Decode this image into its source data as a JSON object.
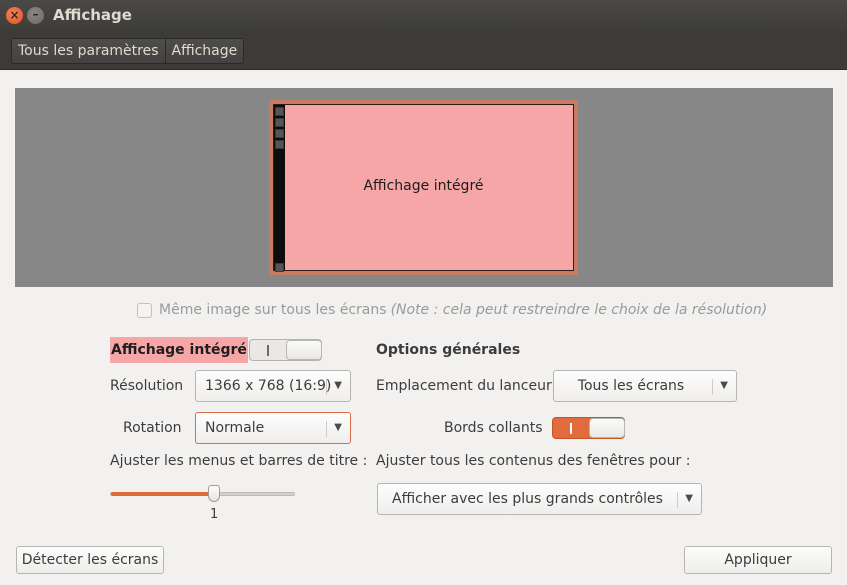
{
  "window": {
    "title": "Affichage",
    "close_glyph": "×",
    "minimize_glyph": "–"
  },
  "breadcrumb": {
    "items": [
      "Tous les paramètres",
      "Affichage"
    ]
  },
  "arrangement": {
    "monitor_label": "Affichage intégré"
  },
  "mirror": {
    "label": "Même image sur tous les écrans",
    "note": "(Note : cela peut restreindre le choix de la résolution)",
    "checked": false,
    "enabled": false
  },
  "display": {
    "name": "Affichage intégré",
    "enabled_toggle": {
      "on": false,
      "glyph": "|"
    },
    "resolution": {
      "label": "Résolution",
      "value": "1366 x 768 (16:9)"
    },
    "rotation": {
      "label": "Rotation",
      "value": "Normale"
    },
    "scale": {
      "label": "Ajuster les menus et barres de titre :",
      "value": "1",
      "level_fraction": 0.56
    }
  },
  "general": {
    "title": "Options générales",
    "launcher": {
      "label": "Emplacement du lanceur",
      "value": "Tous les écrans"
    },
    "sticky_edges": {
      "label": "Bords collants",
      "on": true,
      "glyph": "|"
    },
    "scale_all": {
      "label": "Ajuster tous les contenus des fenêtres pour :",
      "value": "Afficher avec les plus grands contrôles"
    }
  },
  "buttons": {
    "detect": "Détecter les écrans",
    "apply": "Appliquer"
  },
  "arrow_glyph": "▼",
  "colors": {
    "accent": "#e0693b",
    "monitor_fill": "#f6a6a6",
    "titlebar": "#3c3b37"
  }
}
